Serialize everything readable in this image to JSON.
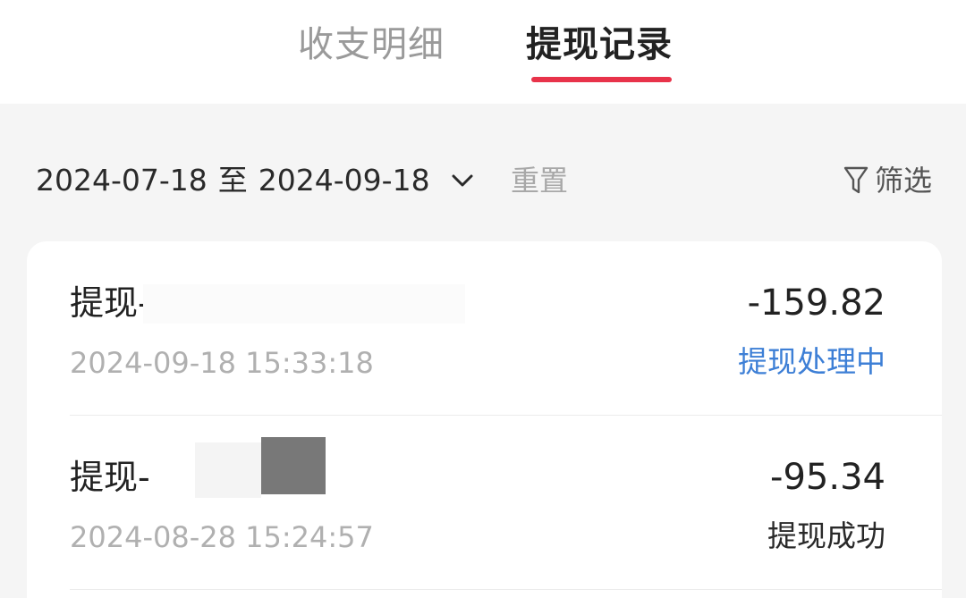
{
  "tabs": {
    "income_expense": "收支明细",
    "withdraw_records": "提现记录",
    "accent_color": "#e8334a"
  },
  "filter": {
    "start_date": "2024-07-18",
    "separator": "至",
    "end_date": "2024-09-18",
    "reset_label": "重置",
    "filter_label": "筛选",
    "dropdown_icon": "chevron-down-icon",
    "filter_icon": "funnel-icon"
  },
  "records": [
    {
      "title": "提现-",
      "time": "2024-09-18 15:33:18",
      "amount": "-159.82",
      "status": "提现处理中",
      "status_color": "#3d7fd6"
    },
    {
      "title": "提现-",
      "time": "2024-08-28 15:24:57",
      "amount": "-95.34",
      "status": "提现成功",
      "status_color": "#2a2a2a"
    }
  ]
}
